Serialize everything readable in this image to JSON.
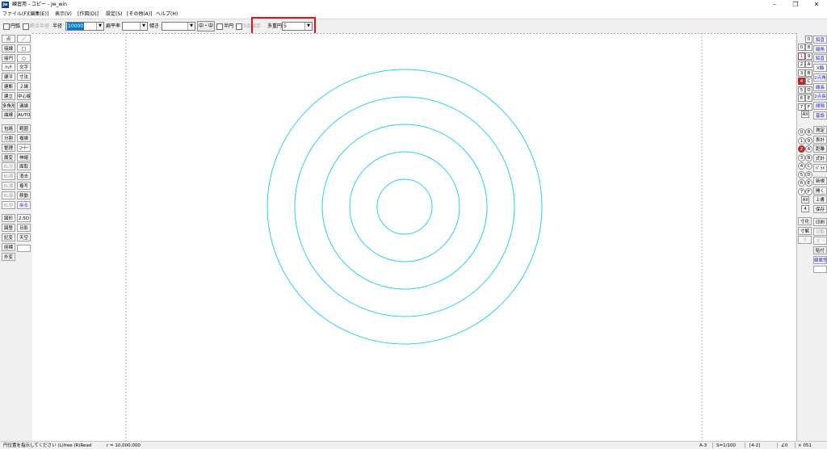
{
  "window": {
    "title": "練習用 - コピー - jw_win",
    "icon_text": "jw"
  },
  "menu": [
    "ファイル(F)",
    "[編集(E)]",
    "表示(V)",
    "[作図(D)]",
    "設定(S)",
    "[その他(A)]",
    "ヘルプ(H)"
  ],
  "toolbar": {
    "circle_arc_label": "円弧",
    "endpoint_radius_label": "終点半径",
    "radius_label": "半径",
    "radius_value": "10000",
    "flatness_label": "扁平率",
    "flatness_value": "",
    "tilt_label": "傾き",
    "tilt_value": "",
    "base_button": "中・中",
    "half_circle_label": "半円",
    "three_point_label": "3点指示",
    "multi_circle_label": "多重円",
    "multi_circle_value": "5"
  },
  "left_palette": [
    [
      "点",
      "／"
    ],
    [
      "接線",
      "□"
    ],
    [
      "接円",
      "○"
    ],
    [
      "ﾊｯﾁ",
      "文字"
    ],
    [
      "建平",
      "寸法"
    ],
    [
      "建断",
      "２線"
    ],
    [
      "建立",
      "中心線"
    ],
    [
      "多角形",
      "連線"
    ],
    [
      "曲線",
      "AUTO"
    ],
    [
      "包絡",
      "範囲"
    ],
    [
      "分割",
      "複線"
    ],
    [
      "整理",
      "ｺｰﾅｰ"
    ],
    [
      "属変",
      "伸縮"
    ],
    [
      "BL化",
      "面取"
    ],
    [
      "BL解",
      "消去"
    ],
    [
      "BL属",
      "複写"
    ],
    [
      "BL編",
      "移動"
    ],
    [
      "BL終",
      "戻る"
    ],
    [
      "図形",
      "2.5D"
    ],
    [
      "図登",
      "日影"
    ],
    [
      "記変",
      "天空"
    ],
    [
      "座標",
      ""
    ],
    [
      "外変",
      ""
    ]
  ],
  "right_palette": {
    "layer_group_label": "0",
    "layer_labels": [
      "0",
      "1",
      "2",
      "3",
      "4",
      "5",
      "6",
      "7"
    ],
    "layer_group_letters": [
      "8",
      "9",
      "A",
      "B",
      "C",
      "D",
      "E",
      "F"
    ],
    "all_label": "All",
    "group_all_label": "All",
    "group_all_value": "4",
    "commands_top": [
      "鉛直",
      "線角",
      "鉛直",
      "X軸",
      "2点角",
      "線長",
      "2点長",
      "間隔",
      "基設"
    ],
    "commands_mid": [
      "測定",
      "表計",
      "距離",
      "式計",
      "ﾊﾟﾗﾒ"
    ],
    "commands_file": [
      "新規",
      "開く",
      "上書",
      "保存",
      "印刷",
      "切取",
      "ｺﾋﾟｰ",
      "貼付",
      "線属性"
    ],
    "commands_left": [
      "寸化",
      "寸解",
      "寸"
    ]
  },
  "circles": {
    "color": "#27d4e4",
    "count": 5
  },
  "status": {
    "message": "円位置を指示してください (L)free (R)Read",
    "radius_readout": "r = 10,000.000",
    "paper": "A-3",
    "scale": "S=1/100",
    "layer": "[4-2]",
    "angle": "∠0",
    "zoom": "× 051"
  }
}
